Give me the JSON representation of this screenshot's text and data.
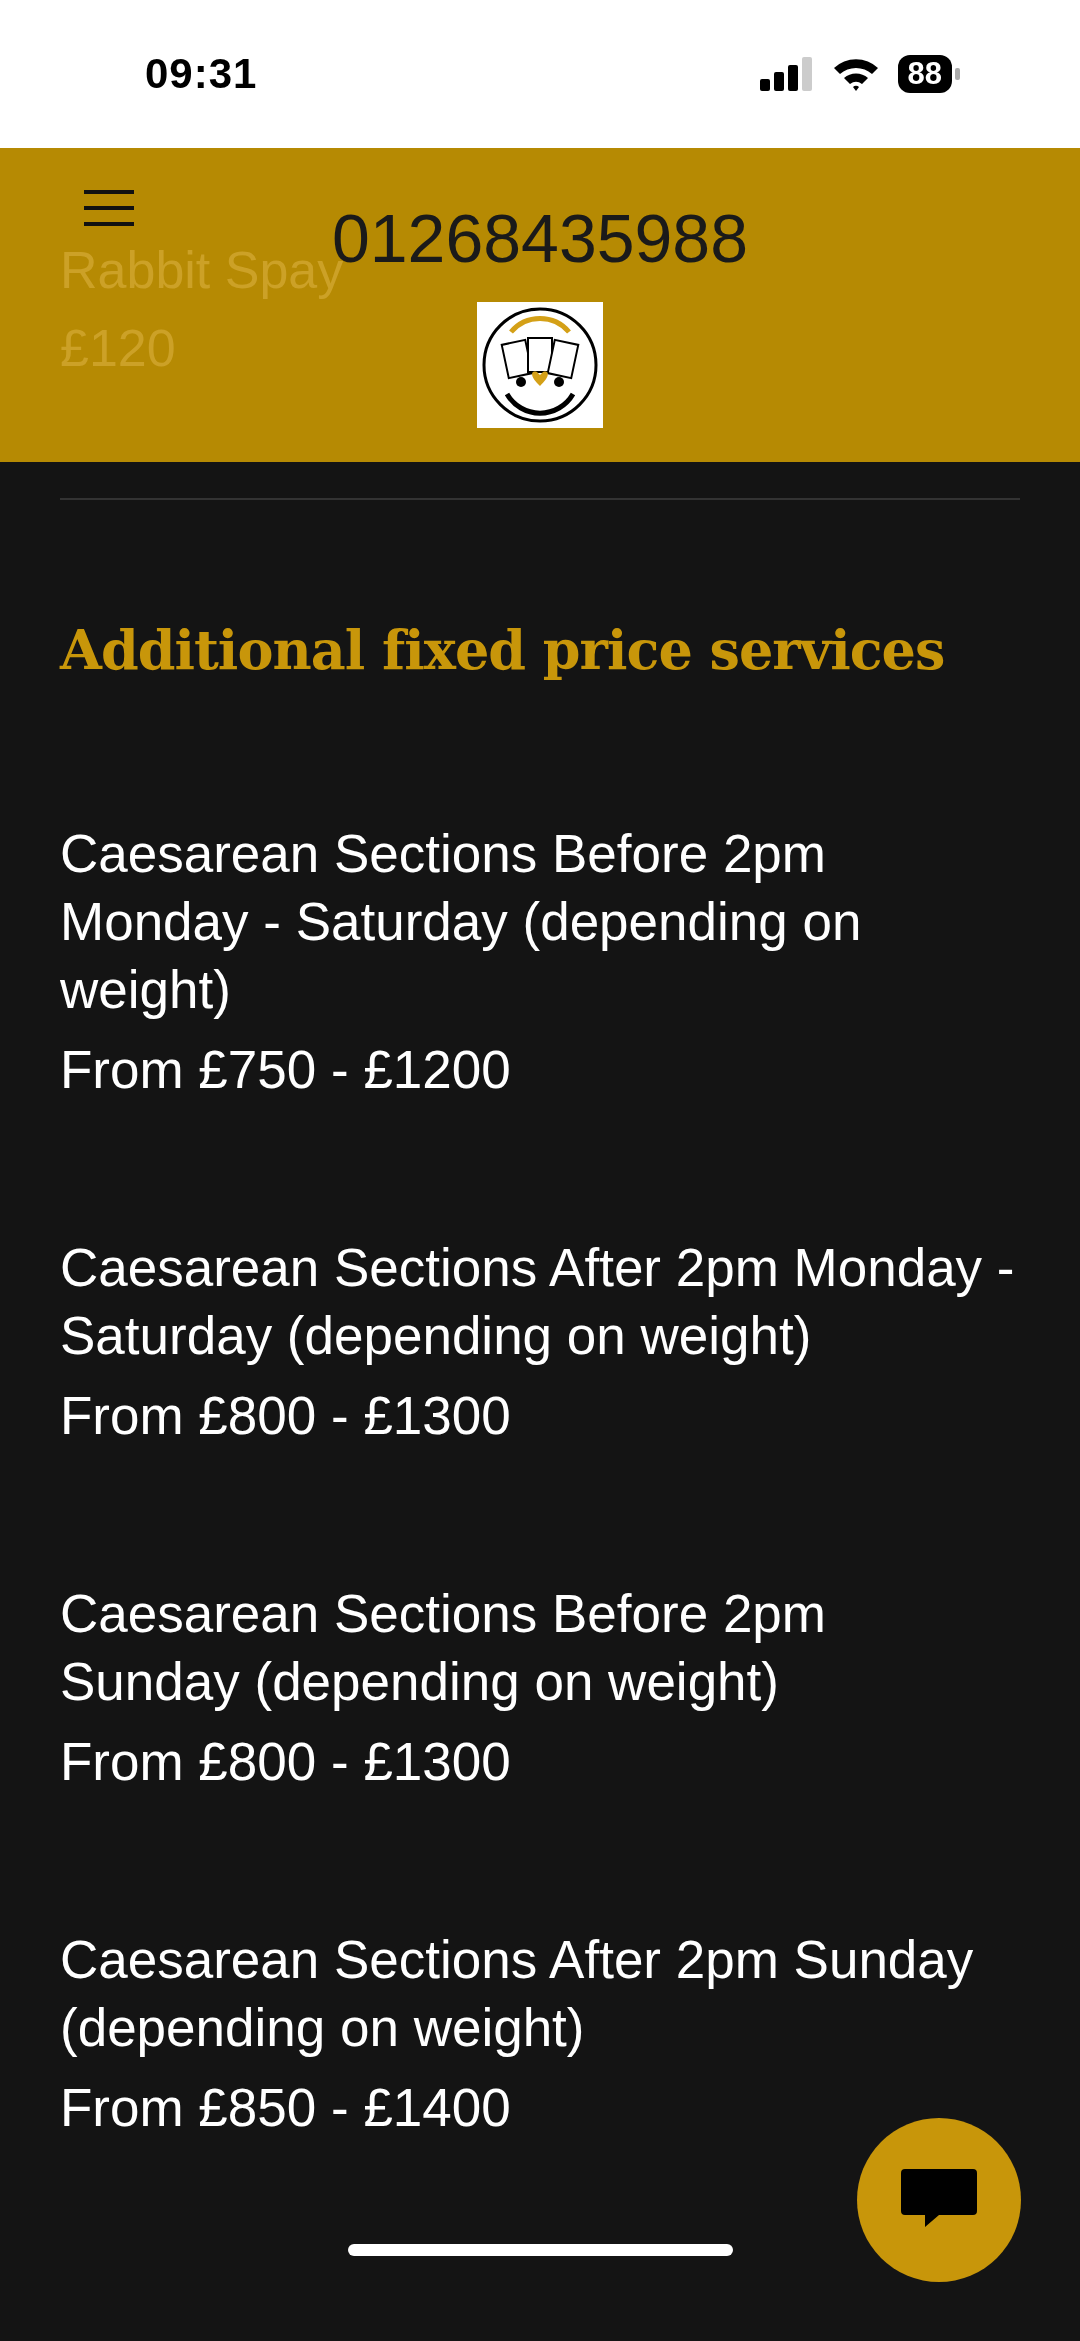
{
  "status_bar": {
    "time": "09:31",
    "battery": "88"
  },
  "header": {
    "phone": "01268435988",
    "behind": [
      "Rabbit Spay",
      "£120"
    ]
  },
  "section": {
    "title": "Additional fixed price services",
    "services": [
      {
        "name": "Caesarean Sections Before 2pm Monday - Saturday (depending on weight)",
        "price": "From £750 - £1200"
      },
      {
        "name": "Caesarean Sections After 2pm Monday - Saturday (depending on weight)",
        "price": "From £800 - £1300"
      },
      {
        "name": "Caesarean Sections Before 2pm Sunday (depending on weight)",
        "price": "From £800 - £1300"
      },
      {
        "name": "Caesarean Sections After 2pm Sunday (depending on weight)",
        "price": "From £850 - £1400"
      }
    ]
  }
}
